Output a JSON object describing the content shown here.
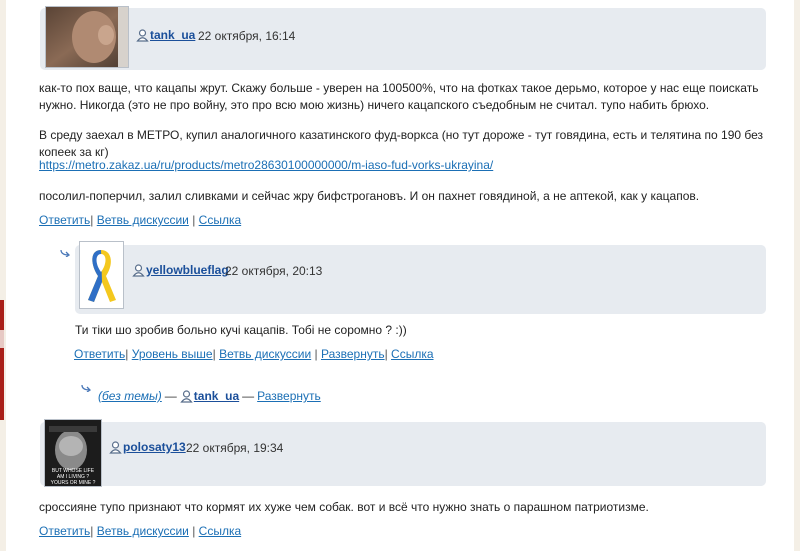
{
  "comments": [
    {
      "user": "tank_ua",
      "date": "22 октября, 16:14",
      "paragraphs": [
        "как-то пох ваще, что кацапы жрут. Скажу больше - уверен на 100500%, что на фотках такое дерьмо, которое у нас еще поискать нужно. Никогда (это не про войну, это про всю мою жизнь) ничего кацапского съедобным не считал. тупо набить брюхо.",
        "В среду заехал в МЕТРО, купил аналогичного казатинского фуд-воркса (но тут дороже - тут говядина, есть и телятина по 190 без копеек за кг)",
        "https://metro.zakaz.ua/ru/products/metro28630100000000/m-iaso-fud-vorks-ukrayina/",
        "посолил-поперчил, залил сливками и сейчас жру бифстрогановъ. И он пахнет говядиной, а не аптекой, как у кацапов."
      ],
      "links": [
        "Ответить",
        "Ветвь дискуссии",
        "Ссылка"
      ]
    },
    {
      "user": "yellowblueflag",
      "date": "22 октября, 20:13",
      "paragraphs": [
        "Ти тіки шо зробив больно кучі кацапів. Тобі не соромно ? :))"
      ],
      "links": [
        "Ответить",
        "Уровень выше",
        "Ветвь дискуссии",
        "Развернуть",
        "Ссылка"
      ]
    },
    {
      "user": "polosaty13",
      "date": "22 октября, 19:34",
      "paragraphs": [
        "сроссияне тупо признают что кормят их хуже чем собак. вот и всё что нужно знать о парашном патриотизме."
      ],
      "links": [
        "Ответить",
        "Ветвь дискуссии",
        "Ссылка"
      ]
    }
  ],
  "collapsed": {
    "subject": "(без темы)",
    "dash": "—",
    "user": "tank_ua",
    "expand": "Развернуть"
  },
  "avatar3_caption": "BUT WHOSE LIFE AM I LIVING ? YOURS OR MINE ?",
  "colors": {
    "link": "#1b6fb5",
    "header_bg": "#e7ebf0",
    "user": "#1b4f9a"
  }
}
